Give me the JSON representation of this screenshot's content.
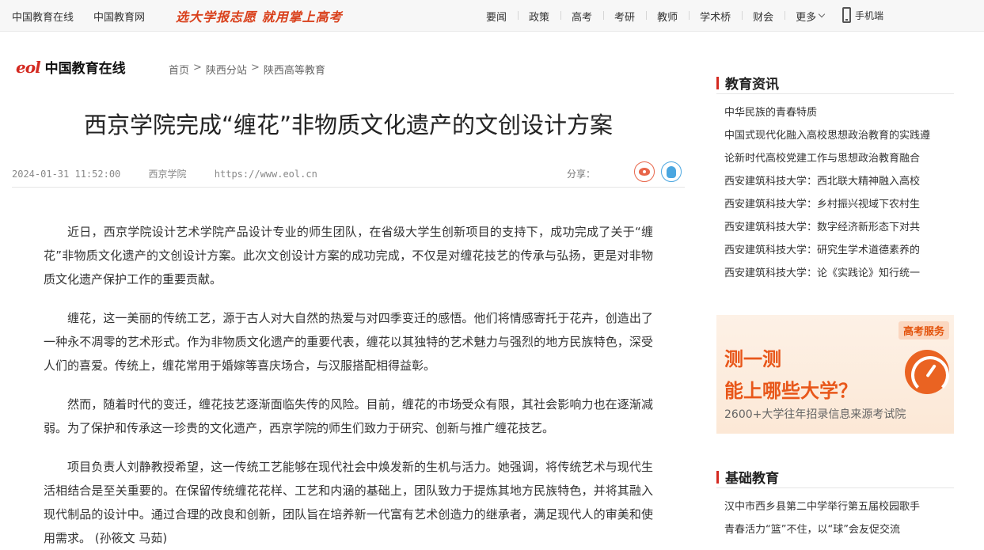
{
  "topbar": {
    "site1": "中国教育在线",
    "site2": "中国教育网",
    "slogan": "选大学报志愿 就用掌上高考",
    "nav": [
      "要闻",
      "政策",
      "高考",
      "考研",
      "教师",
      "学术桥",
      "财会"
    ],
    "more": "更多",
    "mobile": "手机端"
  },
  "logo": {
    "mark": "eol",
    "text": "中国教育在线"
  },
  "breadcrumb": [
    "首页",
    "陕西分站",
    "陕西高等教育"
  ],
  "breadcrumb_sep": ">",
  "article": {
    "title": "西京学院完成“缠花”非物质文化遗产的文创设计方案",
    "date": "2024-01-31 11:52:00",
    "source": "西京学院",
    "url": "https://www.eol.cn",
    "share_label": "分享：",
    "paragraphs": [
      "近日，西京学院设计艺术学院产品设计专业的师生团队，在省级大学生创新项目的支持下，成功完成了关于“缠花”非物质文化遗产的文创设计方案。此次文创设计方案的成功完成，不仅是对缠花技艺的传承与弘扬，更是对非物质文化遗产保护工作的重要贡献。",
      "缠花，这一美丽的传统工艺，源于古人对大自然的热爱与对四季变迁的感悟。他们将情感寄托于花卉，创造出了一种永不凋零的艺术形式。作为非物质文化遗产的重要代表，缠花以其独特的艺术魅力与强烈的地方民族特色，深受人们的喜爱。传统上，缠花常用于婚嫁等喜庆场合，与汉服搭配相得益彰。",
      "然而，随着时代的变迁，缠花技艺逐渐面临失传的风险。目前，缠花的市场受众有限，其社会影响力也在逐渐减弱。为了保护和传承这一珍贵的文化遗产，西京学院的师生们致力于研究、创新与推广缠花技艺。",
      "项目负责人刘静教授希望，这一传统工艺能够在现代社会中焕发新的生机与活力。她强调，将传统艺术与现代生活相结合是至关重要的。在保留传统缠花花样、工艺和内涵的基础上，团队致力于提炼其地方民族特色，并将其融入现代制品的设计中。通过合理的改良和创新，团队旨在培养新一代富有艺术创造力的继承者，满足现代人的审美和使用需求。 (孙筱文 马茹)"
    ]
  },
  "sidebar": {
    "news_title": "教育资讯",
    "news_items": [
      "中华民族的青春特质",
      "中国式现代化融入高校思想政治教育的实践遵",
      "论新时代高校党建工作与思想政治教育融合",
      "西安建筑科技大学：西北联大精神融入高校",
      "西安建筑科技大学：乡村振兴视域下农村生",
      "西安建筑科技大学：数字经济新形态下对共",
      "西安建筑科技大学：研究生学术道德素养的",
      "西安建筑科技大学：论《实践论》知行统一"
    ],
    "ad": {
      "badge": "高考服务",
      "line1": "测一测",
      "line2": "能上哪些大学？",
      "sub": "2600+大学往年招录信息来源考试院"
    },
    "basic_title": "基础教育",
    "basic_items": [
      "汉中市西乡县第二中学举行第五届校园歌手",
      "青春活力“篮”不住，以“球”会友促交流"
    ]
  },
  "colors": {
    "brand": "#d42a21",
    "accent": "#e8571a"
  },
  "icons": [
    "phone-icon",
    "chevron-down-icon",
    "weibo-icon",
    "qq-icon",
    "gauge-icon"
  ]
}
